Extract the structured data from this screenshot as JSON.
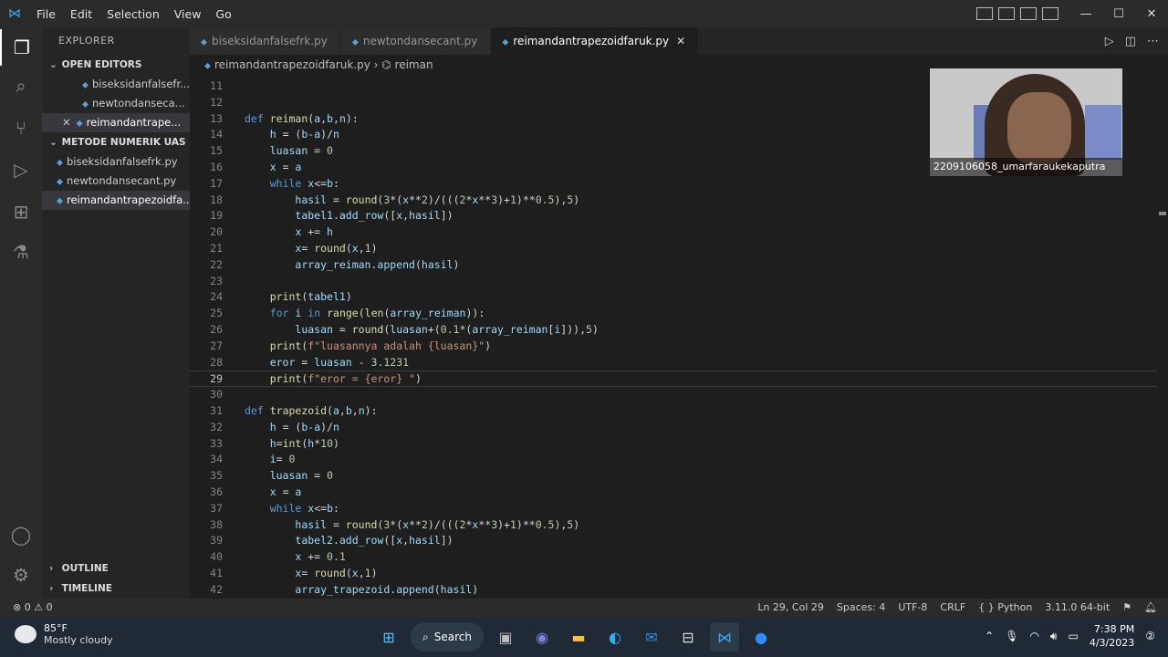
{
  "menu": [
    "File",
    "Edit",
    "Selection",
    "View",
    "Go"
  ],
  "sidebar": {
    "header": "EXPLORER",
    "open_editors_title": "OPEN EDITORS",
    "open_editors": [
      {
        "label": "biseksidanfalsefr..."
      },
      {
        "label": "newtondanseca..."
      },
      {
        "label": "reimandantrape..."
      }
    ],
    "folder_title": "METODE NUMERIK UAS",
    "files": [
      {
        "label": "biseksidanfalsefrk.py"
      },
      {
        "label": "newtondansecant.py"
      },
      {
        "label": "reimandantrapezoidfa..."
      }
    ],
    "outline": "OUTLINE",
    "timeline": "TIMELINE"
  },
  "tabs": [
    {
      "label": "biseksidanfalsefrk.py"
    },
    {
      "label": "newtondansecant.py"
    },
    {
      "label": "reimandantrapezoidfaruk.py"
    }
  ],
  "breadcrumb": {
    "file": "reimandantrapezoidfaruk.py",
    "symbol": "reiman"
  },
  "webcam": {
    "label": "2209106058_umarfaraukekaputra"
  },
  "editor": {
    "lines": [
      {
        "n": "11",
        "code": ""
      },
      {
        "n": "12",
        "code": ""
      },
      {
        "n": "13",
        "code": "def reiman(a,b,n):"
      },
      {
        "n": "14",
        "code": "    h = (b-a)/n"
      },
      {
        "n": "15",
        "code": "    luasan = 0"
      },
      {
        "n": "16",
        "code": "    x = a"
      },
      {
        "n": "17",
        "code": "    while x<=b:"
      },
      {
        "n": "18",
        "code": "        hasil = round(3*(x**2)/(((2*x**3)+1)**0.5),5)"
      },
      {
        "n": "19",
        "code": "        tabel1.add_row([x,hasil])"
      },
      {
        "n": "20",
        "code": "        x += h"
      },
      {
        "n": "21",
        "code": "        x= round(x,1)"
      },
      {
        "n": "22",
        "code": "        array_reiman.append(hasil)"
      },
      {
        "n": "23",
        "code": ""
      },
      {
        "n": "24",
        "code": "    print(tabel1)"
      },
      {
        "n": "25",
        "code": "    for i in range(len(array_reiman)):"
      },
      {
        "n": "26",
        "code": "        luasan = round(luasan+(0.1*(array_reiman[i])),5)"
      },
      {
        "n": "27",
        "code": "    print(f\"luasannya adalah {luasan}\")"
      },
      {
        "n": "28",
        "code": "    eror = luasan - 3.1231"
      },
      {
        "n": "29",
        "code": "    print(f\"eror = {eror} \")"
      },
      {
        "n": "30",
        "code": ""
      },
      {
        "n": "31",
        "code": "def trapezoid(a,b,n):"
      },
      {
        "n": "32",
        "code": "    h = (b-a)/n"
      },
      {
        "n": "33",
        "code": "    h=int(h*10)"
      },
      {
        "n": "34",
        "code": "    i= 0"
      },
      {
        "n": "35",
        "code": "    luasan = 0"
      },
      {
        "n": "36",
        "code": "    x = a"
      },
      {
        "n": "37",
        "code": "    while x<=b:"
      },
      {
        "n": "38",
        "code": "        hasil = round(3*(x**2)/(((2*x**3)+1)**0.5),5)"
      },
      {
        "n": "39",
        "code": "        tabel2.add_row([x,hasil])"
      },
      {
        "n": "40",
        "code": "        x += 0.1"
      },
      {
        "n": "41",
        "code": "        x= round(x,1)"
      },
      {
        "n": "42",
        "code": "        array_trapezoid.append(hasil)"
      }
    ],
    "current_line": "29"
  },
  "status": {
    "left": "⊗ 0 ⚠ 0",
    "ln_col": "Ln 29, Col 29",
    "spaces": "Spaces: 4",
    "encoding": "UTF-8",
    "eol": "CRLF",
    "language": "Python",
    "interpreter": "3.11.0 64-bit"
  },
  "taskbar": {
    "temp": "85°F",
    "weather": "Mostly cloudy",
    "search": "Search",
    "time": "7:38 PM",
    "date": "4/3/2023"
  }
}
